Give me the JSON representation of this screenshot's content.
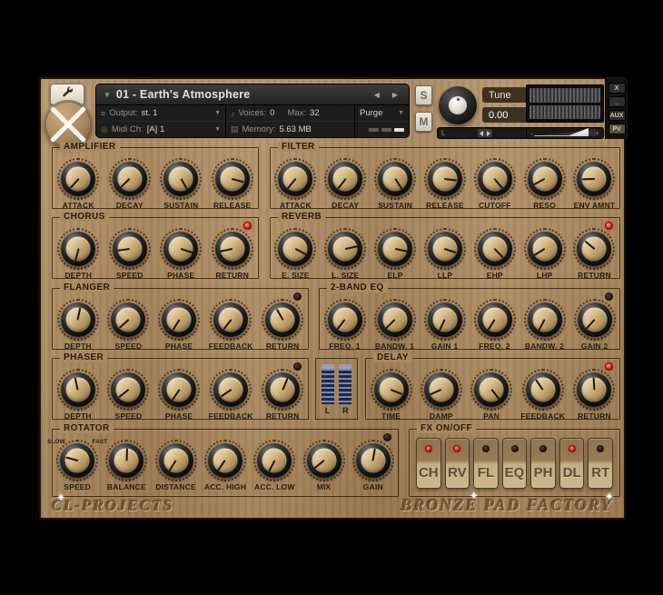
{
  "header": {
    "title": "01 - Earth's Atmosphere",
    "output_label": "Output:",
    "output_value": "st. 1",
    "midi_label": "Midi Ch:",
    "midi_value": "[A] 1",
    "voices_label": "Voices:",
    "voices_value": "0",
    "max_label": "Max:",
    "max_value": "32",
    "purge_label": "Purge",
    "memory_label": "Memory:",
    "memory_value": "5.63 MB",
    "solo_label": "S",
    "mute_label": "M",
    "tune_label": "Tune",
    "tune_value": "0.00",
    "pan_left": "L",
    "pan_right": "R",
    "volume_min": "-",
    "volume_max": "+",
    "window_buttons": {
      "close": "x",
      "minimize": "_",
      "aux": "aux",
      "pv": "pv"
    }
  },
  "icons": {
    "title_caret": "▼",
    "prev": "◀",
    "next": "▶",
    "select_caret": "▼",
    "output": "≡",
    "midi": "◎",
    "voices": "♪",
    "memory": "▤",
    "sparkle": "✦"
  },
  "sections": {
    "amplifier": {
      "name": "AMPLIFIER",
      "knobs": [
        {
          "label": "ATTACK",
          "angle": 222
        },
        {
          "label": "DECAY",
          "angle": 226
        },
        {
          "label": "SUSTAIN",
          "angle": 150
        },
        {
          "label": "RELEASE",
          "angle": 105
        }
      ]
    },
    "filter": {
      "name": "FILTER",
      "knobs": [
        {
          "label": "ATTACK",
          "angle": 220
        },
        {
          "label": "DECAY",
          "angle": 218
        },
        {
          "label": "SUSTAIN",
          "angle": 148
        },
        {
          "label": "RELEASE",
          "angle": 97
        },
        {
          "label": "CUTOFF",
          "angle": 140
        },
        {
          "label": "RESO",
          "angle": 242
        },
        {
          "label": "ENV AMNT",
          "angle": 268
        }
      ]
    },
    "chorus": {
      "name": "CHORUS",
      "led": true,
      "knobs": [
        {
          "label": "DEPTH",
          "angle": 195
        },
        {
          "label": "SPEED",
          "angle": 262
        },
        {
          "label": "PHASE",
          "angle": 108
        },
        {
          "label": "RETURN",
          "angle": 258
        }
      ]
    },
    "reverb": {
      "name": "REVERB",
      "led": true,
      "knobs": [
        {
          "label": "E. SIZE",
          "angle": 118
        },
        {
          "label": "L. SIZE",
          "angle": 78
        },
        {
          "label": "ELP",
          "angle": 102
        },
        {
          "label": "LLP",
          "angle": 108
        },
        {
          "label": "EHP",
          "angle": 135
        },
        {
          "label": "LHP",
          "angle": 238
        },
        {
          "label": "RETURN",
          "angle": 310
        }
      ]
    },
    "flanger": {
      "name": "FLANGER",
      "led": false,
      "knobs": [
        {
          "label": "DEPTH",
          "angle": 12
        },
        {
          "label": "SPEED",
          "angle": 228
        },
        {
          "label": "PHASE",
          "angle": 212
        },
        {
          "label": "FEEDBACK",
          "angle": 218
        },
        {
          "label": "RETURN",
          "angle": 330
        }
      ]
    },
    "eq": {
      "name": "2-BAND EQ",
      "led": false,
      "knobs": [
        {
          "label": "FREQ. 1",
          "angle": 218
        },
        {
          "label": "BANDW. 1",
          "angle": 225
        },
        {
          "label": "GAIN 1",
          "angle": 205
        },
        {
          "label": "FREQ. 2",
          "angle": 212
        },
        {
          "label": "BANDW. 2",
          "angle": 208
        },
        {
          "label": "GAIN 2",
          "angle": 222
        }
      ]
    },
    "phaser": {
      "name": "PHASER",
      "led": false,
      "knobs": [
        {
          "label": "DEPTH",
          "angle": 348
        },
        {
          "label": "SPEED",
          "angle": 232
        },
        {
          "label": "PHASE",
          "angle": 214
        },
        {
          "label": "FEEDBACK",
          "angle": 236
        },
        {
          "label": "RETURN",
          "angle": 22
        }
      ]
    },
    "delay": {
      "name": "DELAY",
      "led": true,
      "knobs": [
        {
          "label": "TIME",
          "angle": 112
        },
        {
          "label": "DAMP",
          "angle": 246
        },
        {
          "label": "PAN",
          "angle": 142
        },
        {
          "label": "FEEDBACK",
          "angle": 326
        },
        {
          "label": "RETURN",
          "angle": 356
        }
      ]
    },
    "rotator": {
      "name": "ROTATOR",
      "led": false,
      "knobs": [
        {
          "label": "SPEED",
          "angle": 285,
          "marks": [
            "SLOW",
            "FAST"
          ]
        },
        {
          "label": "BALANCE",
          "angle": 2
        },
        {
          "label": "DISTANCE",
          "angle": 212
        },
        {
          "label": "ACC. HIGH",
          "angle": 214
        },
        {
          "label": "ACC. LOW",
          "angle": 208
        },
        {
          "label": "MIX",
          "angle": 230
        },
        {
          "label": "GAIN",
          "angle": 10
        }
      ]
    }
  },
  "meter_lr": {
    "left": "L",
    "right": "R"
  },
  "fx": {
    "title": "FX ON/OFF",
    "buttons": [
      {
        "label": "CH",
        "on": true
      },
      {
        "label": "RV",
        "on": true
      },
      {
        "label": "FL",
        "on": false
      },
      {
        "label": "EQ",
        "on": false
      },
      {
        "label": "PH",
        "on": false
      },
      {
        "label": "DL",
        "on": true
      },
      {
        "label": "RT",
        "on": false
      }
    ]
  },
  "footer": {
    "left_logo": "CL-PROJECTS",
    "right_logo": "BRONZE PAD FACTORY"
  },
  "colors": {
    "led_on": "#e02518",
    "led_off": "#2a150e",
    "panel": "#ac8a60",
    "accent_cap": "#d9bf8e"
  }
}
